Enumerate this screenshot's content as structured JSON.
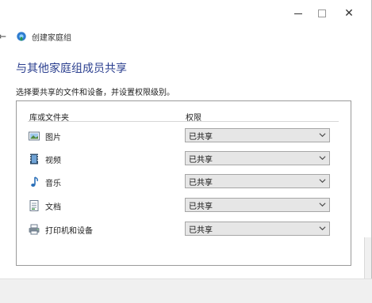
{
  "window": {
    "minimize_glyph": "—",
    "maximize_glyph": "□",
    "close_glyph": "✕"
  },
  "nav": {
    "back_glyph": "←",
    "title": "创建家庭组",
    "icon": "homegroup-icon"
  },
  "page": {
    "heading": "与其他家庭组成员共享",
    "subtitle": "选择要共享的文件和设备，并设置权限级别。"
  },
  "table": {
    "column_library": "库或文件夹",
    "column_permission": "权限",
    "rows": [
      {
        "label": "图片",
        "icon": "pictures-icon",
        "value": "已共享"
      },
      {
        "label": "视频",
        "icon": "videos-icon",
        "value": "已共享"
      },
      {
        "label": "音乐",
        "icon": "music-icon",
        "value": "已共享"
      },
      {
        "label": "文档",
        "icon": "documents-icon",
        "value": "已共享"
      },
      {
        "label": "打印机和设备",
        "icon": "printer-icon",
        "value": "已共享"
      }
    ]
  },
  "colors": {
    "heading": "#2b3f8f",
    "select_bg": "#e6e6e6",
    "panel_border": "#9a9a9a"
  }
}
